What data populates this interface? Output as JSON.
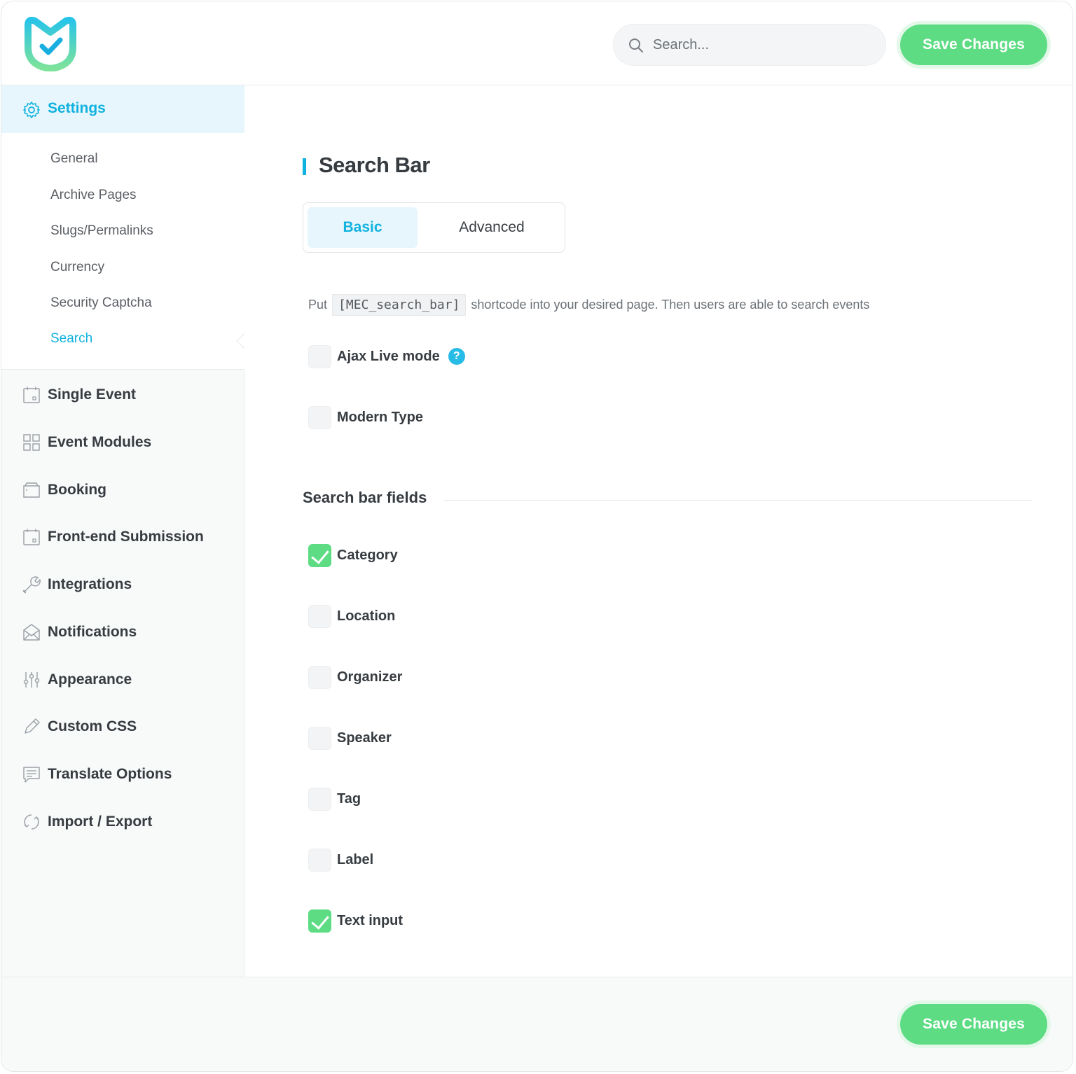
{
  "header": {
    "search_placeholder": "Search...",
    "save_label": "Save Changes"
  },
  "sidebar": {
    "settings_label": "Settings",
    "submenu": [
      {
        "label": "General"
      },
      {
        "label": "Archive Pages"
      },
      {
        "label": "Slugs/Permalinks"
      },
      {
        "label": "Currency"
      },
      {
        "label": "Security Captcha"
      },
      {
        "label": "Search",
        "active": true
      }
    ],
    "items": [
      {
        "label": "Single Event",
        "icon": "calendar-icon"
      },
      {
        "label": "Event Modules",
        "icon": "grid-icon"
      },
      {
        "label": "Booking",
        "icon": "folder-icon"
      },
      {
        "label": "Front-end Submission",
        "icon": "calendar-icon"
      },
      {
        "label": "Integrations",
        "icon": "wrench-icon"
      },
      {
        "label": "Notifications",
        "icon": "envelope-icon"
      },
      {
        "label": "Appearance",
        "icon": "sliders-icon"
      },
      {
        "label": "Custom CSS",
        "icon": "pencil-icon"
      },
      {
        "label": "Translate Options",
        "icon": "chat-icon"
      },
      {
        "label": "Import / Export",
        "icon": "refresh-icon"
      }
    ]
  },
  "main": {
    "title": "Search Bar",
    "tabs": [
      {
        "label": "Basic",
        "active": true
      },
      {
        "label": "Advanced",
        "active": false
      }
    ],
    "description": {
      "before": "Put",
      "code": "[MEC_search_bar]",
      "after": "shortcode into your desired page. Then users are able to search events"
    },
    "options": [
      {
        "label": "Ajax Live mode",
        "checked": false,
        "help": "?"
      },
      {
        "label": "Modern Type",
        "checked": false
      }
    ],
    "section_title": "Search bar fields",
    "fields": [
      {
        "label": "Category",
        "checked": true
      },
      {
        "label": "Location",
        "checked": false
      },
      {
        "label": "Organizer",
        "checked": false
      },
      {
        "label": "Speaker",
        "checked": false
      },
      {
        "label": "Tag",
        "checked": false
      },
      {
        "label": "Label",
        "checked": false
      },
      {
        "label": "Text input",
        "checked": true
      }
    ]
  },
  "footer": {
    "save_label": "Save Changes"
  },
  "colors": {
    "accent": "#10b2df",
    "save": "#5ddc84",
    "check_on": "#5ddc84"
  }
}
